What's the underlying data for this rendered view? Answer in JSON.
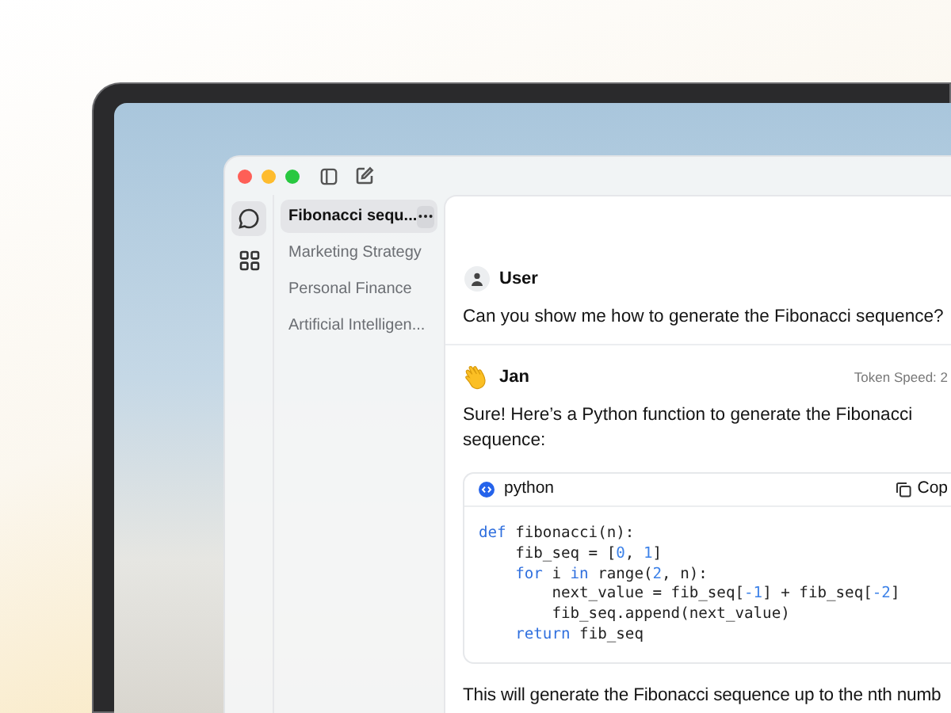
{
  "rail": [
    {
      "kind": "chat",
      "selected": true
    },
    {
      "kind": "grid",
      "selected": false
    }
  ],
  "sidebar": {
    "items": [
      {
        "label": "Fibonacci sequ...",
        "selected": true
      },
      {
        "label": "Marketing Strategy",
        "selected": false
      },
      {
        "label": "Personal Finance",
        "selected": false
      },
      {
        "label": "Artificial Intelligen...",
        "selected": false
      }
    ]
  },
  "messages": [
    {
      "kind": "user",
      "author": "User",
      "blocks": [
        {
          "kind": "text",
          "text": "Can you show me how to generate the Fibonacci sequence?"
        }
      ]
    },
    {
      "kind": "assistant",
      "author": "Jan",
      "meta": "Token Speed: 2",
      "blocks": [
        {
          "kind": "text",
          "text": "Sure! Here’s a Python function to generate the Fibonacci sequence:"
        },
        {
          "kind": "code",
          "language": "python",
          "copy_label": "Cop",
          "lines": [
            [
              {
                "t": "def",
                "kind": "keyword"
              },
              {
                "t": " fibonacci(n):",
                "kind": "plain"
              }
            ],
            [
              {
                "t": "    fib_seq = [",
                "kind": "plain"
              },
              {
                "t": "0",
                "kind": "number"
              },
              {
                "t": ", ",
                "kind": "plain"
              },
              {
                "t": "1",
                "kind": "number"
              },
              {
                "t": "]",
                "kind": "plain"
              }
            ],
            [
              {
                "t": "    for",
                "kind": "keyword"
              },
              {
                "t": " i ",
                "kind": "plain"
              },
              {
                "t": "in",
                "kind": "keyword"
              },
              {
                "t": " range(",
                "kind": "plain"
              },
              {
                "t": "2",
                "kind": "number"
              },
              {
                "t": ", n):",
                "kind": "plain"
              }
            ],
            [
              {
                "t": "        next_value = fib_seq[",
                "kind": "plain"
              },
              {
                "t": "-1",
                "kind": "number"
              },
              {
                "t": "] + fib_seq[",
                "kind": "plain"
              },
              {
                "t": "-2",
                "kind": "number"
              },
              {
                "t": "]",
                "kind": "plain"
              }
            ],
            [
              {
                "t": "        fib_seq.append(next_value)",
                "kind": "plain"
              }
            ],
            [
              {
                "t": "    return",
                "kind": "keyword"
              },
              {
                "t": " fib_seq",
                "kind": "plain"
              }
            ]
          ]
        },
        {
          "kind": "trailing_text",
          "text": "This will generate the Fibonacci sequence up to the nth numb"
        }
      ]
    }
  ]
}
